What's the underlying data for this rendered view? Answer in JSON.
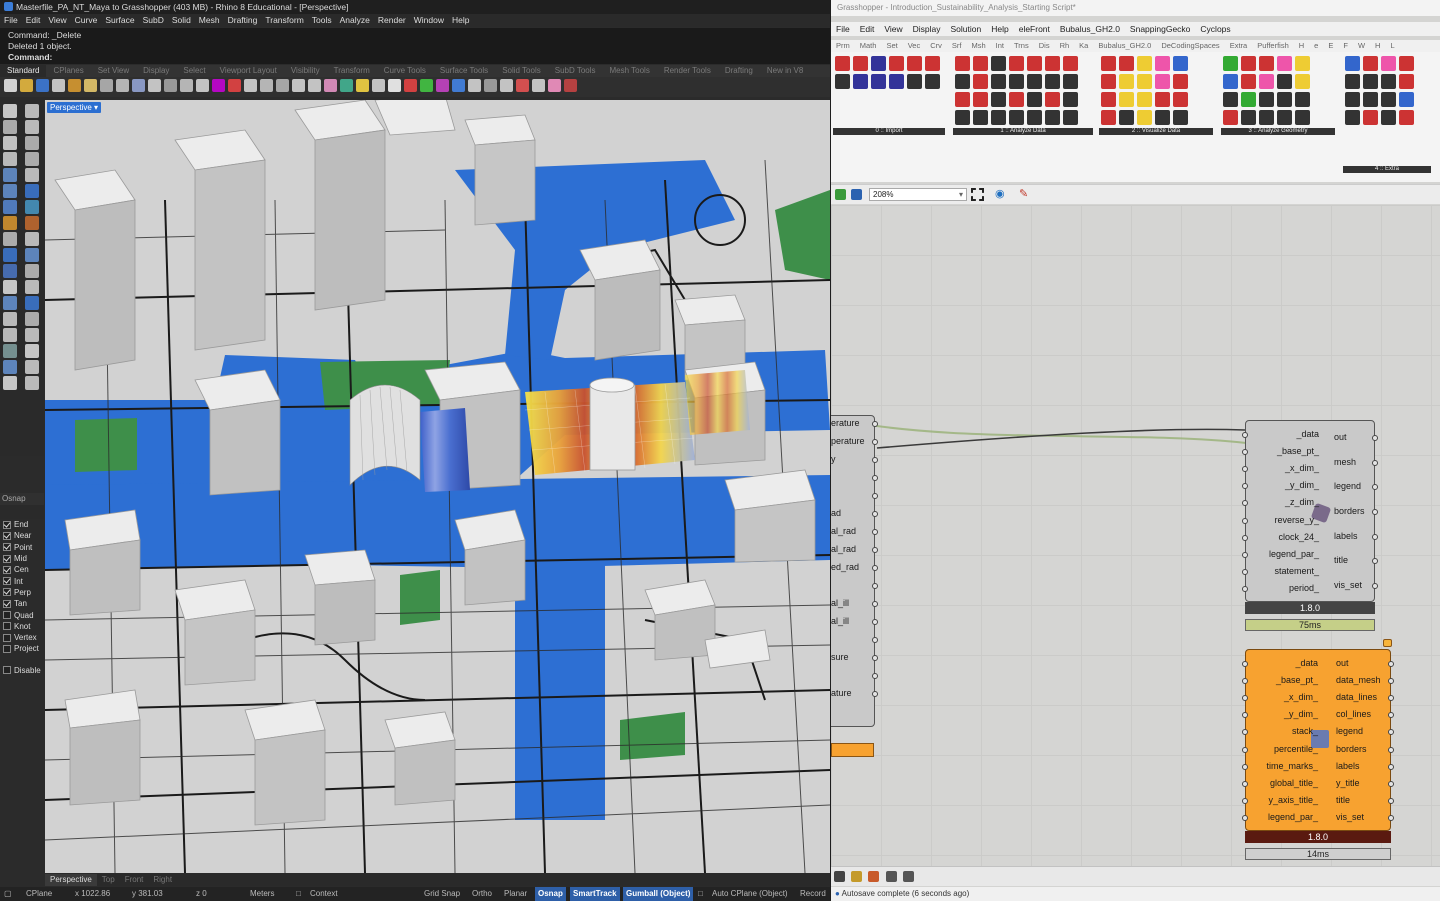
{
  "rhino": {
    "title": "Masterfile_PA_NT_Maya to Grasshopper (403 MB) - Rhino 8 Educational - [Perspective]",
    "menu": [
      "File",
      "Edit",
      "View",
      "Curve",
      "Surface",
      "SubD",
      "Solid",
      "Mesh",
      "Drafting",
      "Transform",
      "Tools",
      "Analyze",
      "Render",
      "Window",
      "Help"
    ],
    "command_history": [
      "Command: _Delete",
      "Deleted 1 object."
    ],
    "command_prompt": "Command:",
    "toolbar_tabs": [
      "Standard",
      "CPlanes",
      "Set View",
      "Display",
      "Select",
      "Viewport Layout",
      "Visibility",
      "Transform",
      "Curve Tools",
      "Surface Tools",
      "Solid Tools",
      "SubD Tools",
      "Mesh Tools",
      "Render Tools",
      "Drafting",
      "New in V8"
    ],
    "viewport_label": "Perspective",
    "osnap_title": "Osnap",
    "osnaps": [
      {
        "label": "End",
        "checked": true
      },
      {
        "label": "Near",
        "checked": true
      },
      {
        "label": "Point",
        "checked": true
      },
      {
        "label": "Mid",
        "checked": true
      },
      {
        "label": "Cen",
        "checked": true
      },
      {
        "label": "Int",
        "checked": true
      },
      {
        "label": "Perp",
        "checked": true
      },
      {
        "label": "Tan",
        "checked": true
      },
      {
        "label": "Quad",
        "checked": false
      },
      {
        "label": "Knot",
        "checked": false
      },
      {
        "label": "Vertex",
        "checked": false
      },
      {
        "label": "Project",
        "checked": false
      }
    ],
    "osnap_disable": "Disable",
    "view_tabs": [
      "Perspective",
      "Top",
      "Front",
      "Right"
    ],
    "status": {
      "cplane": "CPlane",
      "x": "x 1022.86",
      "y": "y 381.03",
      "z": "z 0",
      "units": "Meters",
      "layer": "Context",
      "grid_snap": "Grid Snap",
      "ortho": "Ortho",
      "planar": "Planar",
      "osnap": "Osnap",
      "smarttrack": "SmartTrack",
      "gumball": "Gumball (Object)",
      "auto_cplane": "Auto CPlane (Object)",
      "record": "Record"
    }
  },
  "grasshopper": {
    "title": "Grasshopper - Introduction_Sustainability_Analysis_Starting Script*",
    "menu": [
      "File",
      "Edit",
      "View",
      "Display",
      "Solution",
      "Help",
      "eleFront",
      "Bubalus_GH2.0",
      "SnappingGecko",
      "Cyclops"
    ],
    "subtabs": [
      "Prm",
      "Math",
      "Set",
      "Vec",
      "Crv",
      "Srf",
      "Msh",
      "Int",
      "Trns",
      "Dis",
      "Rh",
      "Ka",
      "Bubalus_GH2.0",
      "DeCodingSpaces",
      "Extra",
      "Pufferfish",
      "H",
      "e",
      "E",
      "F",
      "W",
      "H",
      "L"
    ],
    "ribbon_groups": [
      "0 :: Import",
      "1 :: Analyze Data",
      "2 :: Visualize Data",
      "3 :: Analyze Geometry",
      "4 :: Extra"
    ],
    "zoom": "208%",
    "left_component_inputs": [
      "erature",
      "perature",
      "y",
      "",
      "",
      "ad",
      "al_rad",
      "al_rad",
      "ed_rad",
      "",
      "al_ill",
      "al_ill",
      "",
      "sure",
      "",
      "ature"
    ],
    "component1": {
      "inputs": [
        "_data",
        "_base_pt_",
        "_x_dim_",
        "_y_dim_",
        "_z_dim_",
        "reverse_y_",
        "clock_24_",
        "legend_par_",
        "statement_",
        "period_"
      ],
      "outputs": [
        "out",
        "mesh",
        "legend",
        "borders",
        "labels",
        "title",
        "vis_set"
      ],
      "version": "1.8.0",
      "timing": "75ms"
    },
    "component2": {
      "inputs": [
        "_data",
        "_base_pt_",
        "_x_dim_",
        "_y_dim_",
        "stack_",
        "percentile_",
        "time_marks_",
        "global_title_",
        "y_axis_title_",
        "legend_par_"
      ],
      "outputs": [
        "out",
        "data_mesh",
        "data_lines",
        "col_lines",
        "legend",
        "borders",
        "labels",
        "y_title",
        "title",
        "vis_set"
      ],
      "version": "1.8.0",
      "timing": "14ms"
    },
    "status": "Autosave complete (6 seconds ago)"
  }
}
